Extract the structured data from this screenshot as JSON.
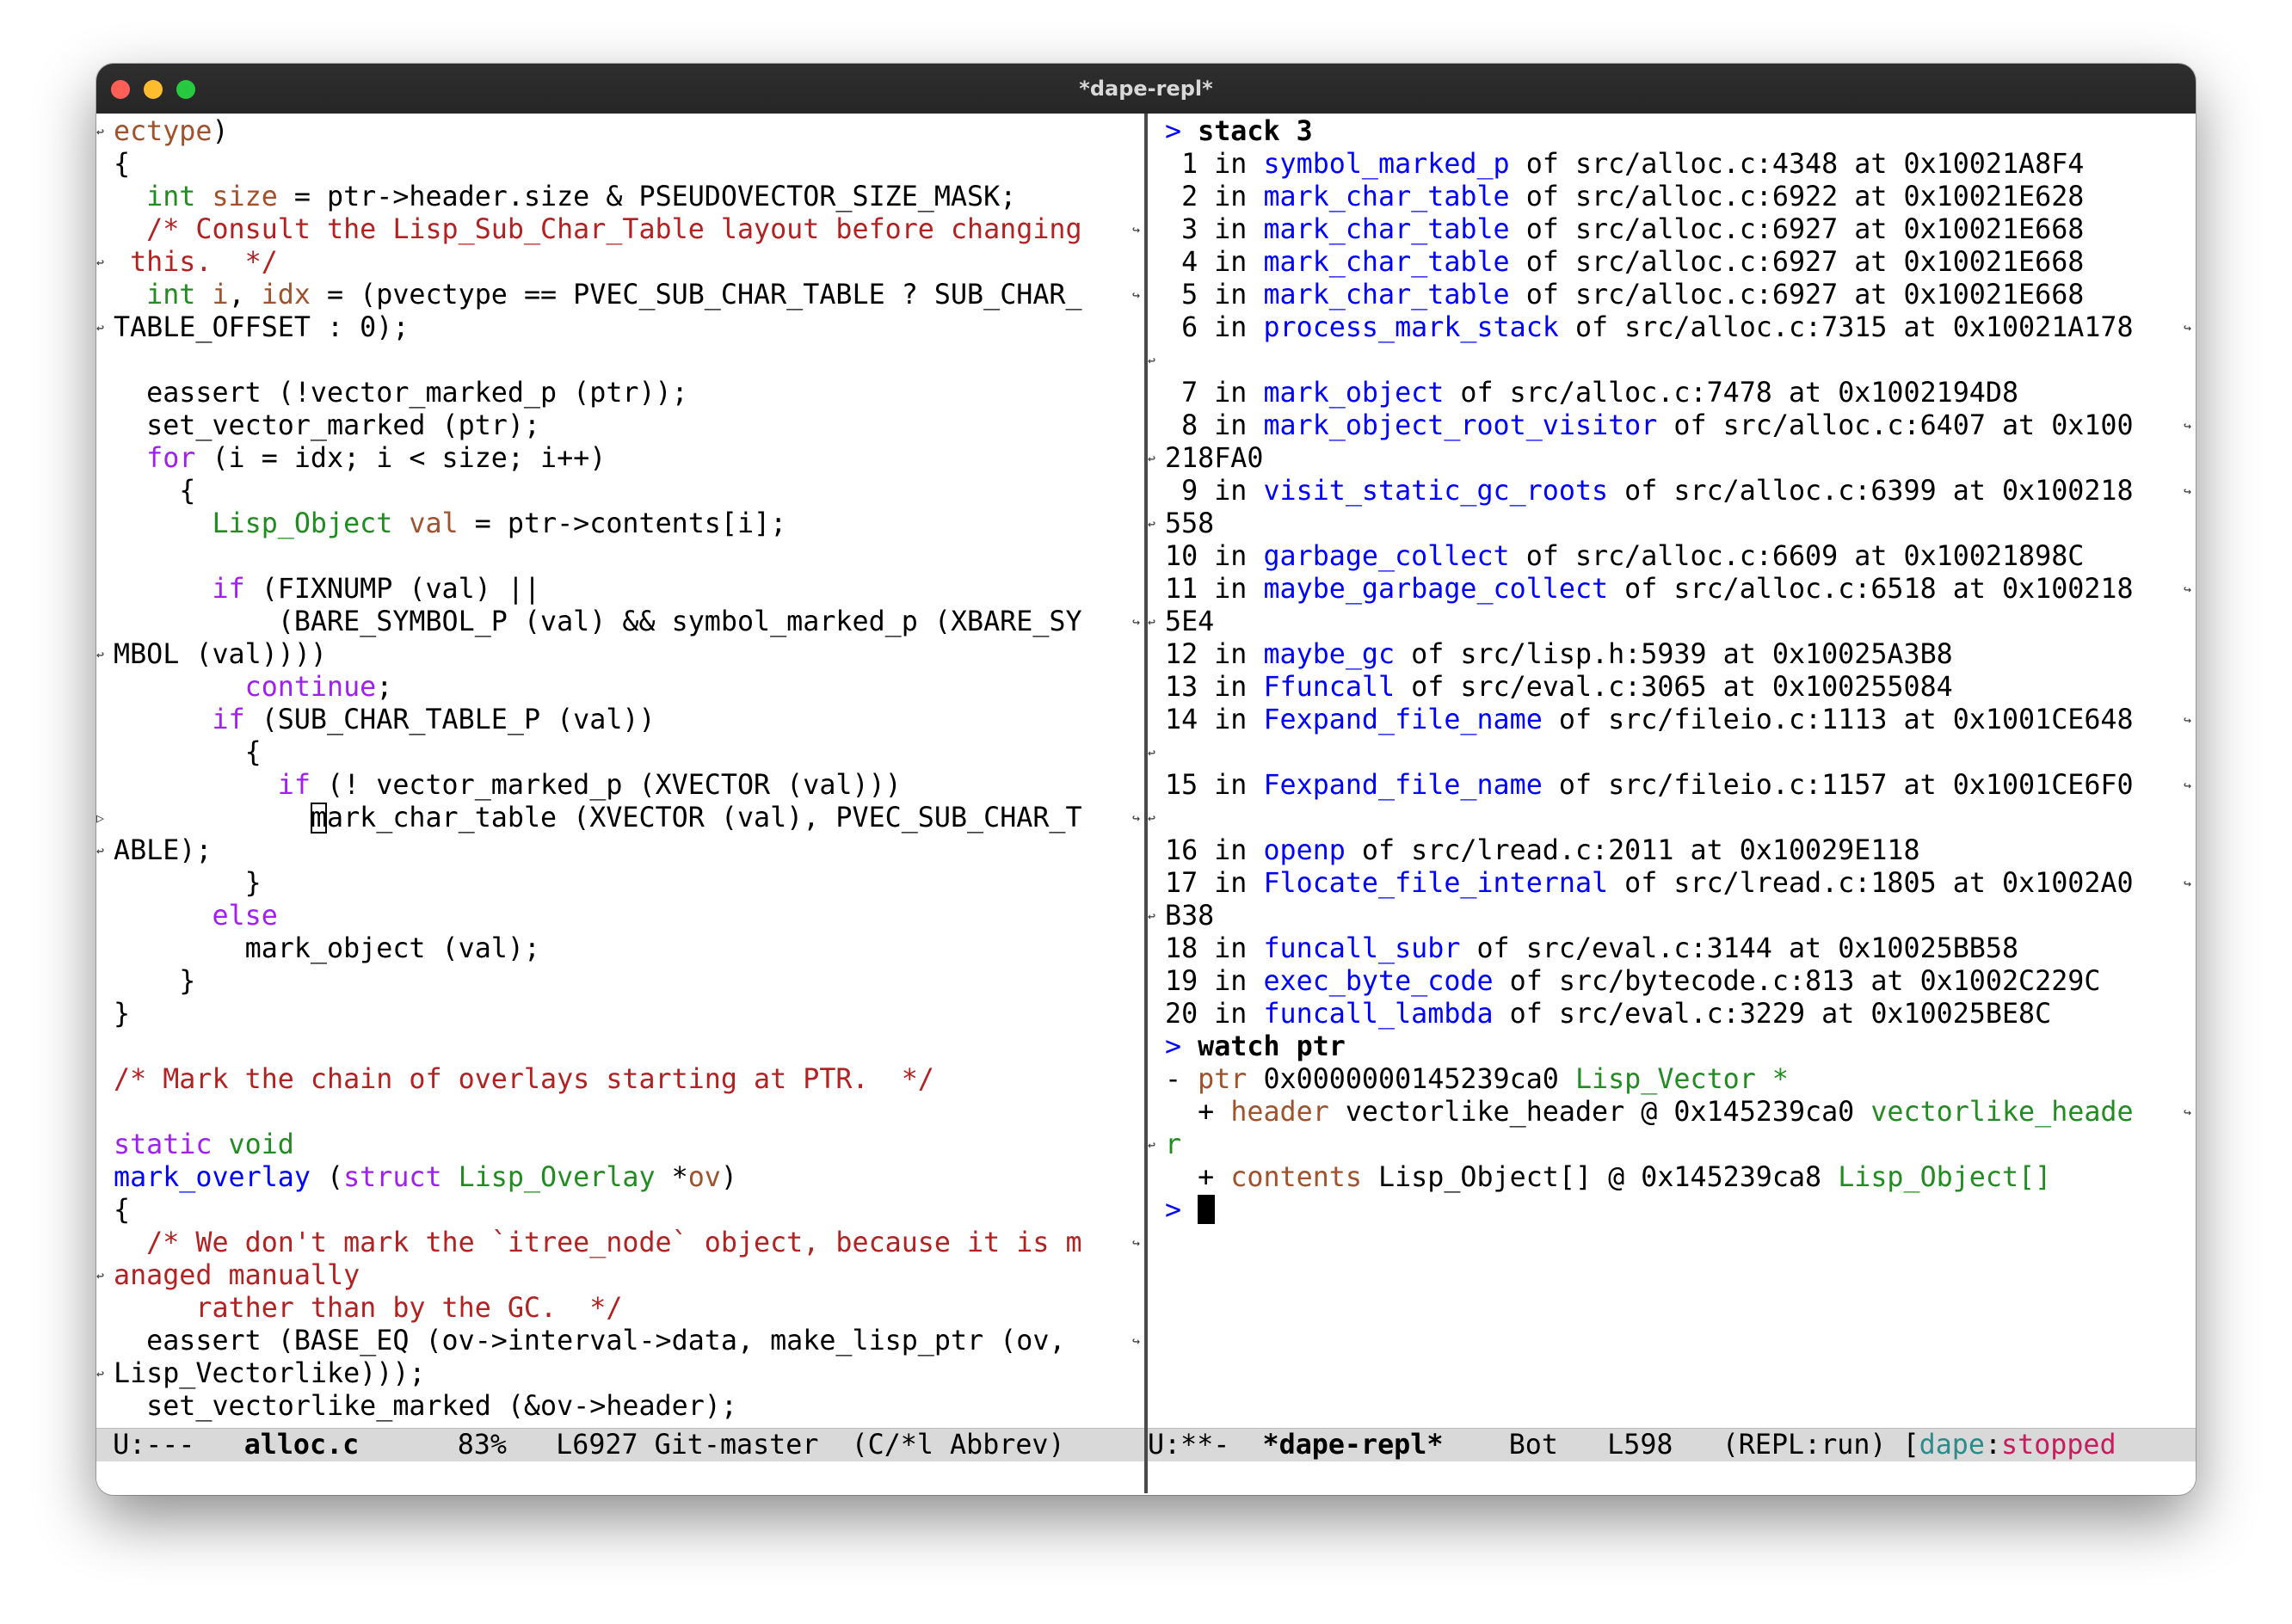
{
  "window": {
    "title": "*dape-repl*"
  },
  "left_pane": {
    "lines": [
      {
        "g": "↩",
        "segs": [
          {
            "c": "vn",
            "t": "ectype"
          },
          {
            "t": ")"
          }
        ]
      },
      {
        "g": "",
        "segs": [
          {
            "t": "{"
          }
        ]
      },
      {
        "g": "",
        "segs": [
          {
            "t": "  "
          },
          {
            "c": "ty",
            "t": "int"
          },
          {
            "t": " "
          },
          {
            "c": "vn",
            "t": "size"
          },
          {
            "t": " = ptr->header.size & PSEUDOVECTOR_SIZE_MASK;"
          }
        ]
      },
      {
        "g": "",
        "r": "↪",
        "segs": [
          {
            "t": "  "
          },
          {
            "c": "cm",
            "t": "/* Consult the Lisp_Sub_Char_Table layout before changing"
          }
        ]
      },
      {
        "g": "↩",
        "segs": [
          {
            "c": "cm",
            "t": " this.  */"
          }
        ]
      },
      {
        "g": "",
        "r": "↪",
        "segs": [
          {
            "t": "  "
          },
          {
            "c": "ty",
            "t": "int"
          },
          {
            "t": " "
          },
          {
            "c": "vn",
            "t": "i"
          },
          {
            "t": ", "
          },
          {
            "c": "vn",
            "t": "idx"
          },
          {
            "t": " = (pvectype == PVEC_SUB_CHAR_TABLE ? SUB_CHAR_"
          }
        ]
      },
      {
        "g": "↩",
        "segs": [
          {
            "t": "TABLE_OFFSET : 0);"
          }
        ]
      },
      {
        "g": "",
        "segs": [
          {
            "t": ""
          }
        ]
      },
      {
        "g": "",
        "segs": [
          {
            "t": "  eassert (!vector_marked_p (ptr));"
          }
        ]
      },
      {
        "g": "",
        "segs": [
          {
            "t": "  set_vector_marked (ptr);"
          }
        ]
      },
      {
        "g": "",
        "segs": [
          {
            "t": "  "
          },
          {
            "c": "kw",
            "t": "for"
          },
          {
            "t": " (i = idx; i < size; i++)"
          }
        ]
      },
      {
        "g": "",
        "segs": [
          {
            "t": "    {"
          }
        ]
      },
      {
        "g": "",
        "segs": [
          {
            "t": "      "
          },
          {
            "c": "ty",
            "t": "Lisp_Object"
          },
          {
            "t": " "
          },
          {
            "c": "vn",
            "t": "val"
          },
          {
            "t": " = ptr->contents[i];"
          }
        ]
      },
      {
        "g": "",
        "segs": [
          {
            "t": ""
          }
        ]
      },
      {
        "g": "",
        "segs": [
          {
            "t": "      "
          },
          {
            "c": "kw",
            "t": "if"
          },
          {
            "t": " (FIXNUMP (val) ||"
          }
        ]
      },
      {
        "g": "",
        "r": "↪",
        "segs": [
          {
            "t": "          (BARE_SYMBOL_P (val) && symbol_marked_p (XBARE_SY"
          }
        ]
      },
      {
        "g": "↩",
        "segs": [
          {
            "t": "MBOL (val))))"
          }
        ]
      },
      {
        "g": "",
        "segs": [
          {
            "t": "        "
          },
          {
            "c": "kw",
            "t": "continue"
          },
          {
            "t": ";"
          }
        ]
      },
      {
        "g": "",
        "segs": [
          {
            "t": "      "
          },
          {
            "c": "kw",
            "t": "if"
          },
          {
            "t": " (SUB_CHAR_TABLE_P (val))"
          }
        ]
      },
      {
        "g": "",
        "segs": [
          {
            "t": "        {"
          }
        ]
      },
      {
        "g": "",
        "segs": [
          {
            "t": "          "
          },
          {
            "c": "kw",
            "t": "if"
          },
          {
            "t": " (! vector_marked_p (XVECTOR (val)))"
          }
        ]
      },
      {
        "g": "▷",
        "r": "↪",
        "segs": [
          {
            "t": "            "
          },
          {
            "c": "cursor",
            "t": "m"
          },
          {
            "t": "ark_char_table (XVECTOR (val), PVEC_SUB_CHAR_T"
          }
        ]
      },
      {
        "g": "↩",
        "segs": [
          {
            "t": "ABLE);"
          }
        ]
      },
      {
        "g": "",
        "segs": [
          {
            "t": "        }"
          }
        ]
      },
      {
        "g": "",
        "segs": [
          {
            "t": "      "
          },
          {
            "c": "kw",
            "t": "else"
          }
        ]
      },
      {
        "g": "",
        "segs": [
          {
            "t": "        mark_object (val);"
          }
        ]
      },
      {
        "g": "",
        "segs": [
          {
            "t": "    }"
          }
        ]
      },
      {
        "g": "",
        "segs": [
          {
            "t": "}"
          }
        ]
      },
      {
        "g": "",
        "segs": [
          {
            "t": ""
          }
        ]
      },
      {
        "g": "",
        "segs": [
          {
            "c": "cm",
            "t": "/* Mark the chain of overlays starting at PTR.  */"
          }
        ]
      },
      {
        "g": "",
        "segs": [
          {
            "t": ""
          }
        ]
      },
      {
        "g": "",
        "segs": [
          {
            "c": "kw",
            "t": "static"
          },
          {
            "t": " "
          },
          {
            "c": "ty",
            "t": "void"
          }
        ]
      },
      {
        "g": "",
        "segs": [
          {
            "c": "fn",
            "t": "mark_overlay"
          },
          {
            "t": " ("
          },
          {
            "c": "kw",
            "t": "struct"
          },
          {
            "t": " "
          },
          {
            "c": "ty",
            "t": "Lisp_Overlay"
          },
          {
            "t": " *"
          },
          {
            "c": "vn",
            "t": "ov"
          },
          {
            "t": ")"
          }
        ]
      },
      {
        "g": "",
        "segs": [
          {
            "t": "{"
          }
        ]
      },
      {
        "g": "",
        "r": "↪",
        "segs": [
          {
            "t": "  "
          },
          {
            "c": "cm",
            "t": "/* We don't mark the `itree_node` object, because it is m"
          }
        ]
      },
      {
        "g": "↩",
        "segs": [
          {
            "c": "cm",
            "t": "anaged manually"
          }
        ]
      },
      {
        "g": "",
        "segs": [
          {
            "c": "cm",
            "t": "     rather than by the GC.  */"
          }
        ]
      },
      {
        "g": "",
        "r": "↪",
        "segs": [
          {
            "t": "  eassert (BASE_EQ (ov->interval->data, make_lisp_ptr (ov, "
          }
        ]
      },
      {
        "g": "↩",
        "segs": [
          {
            "t": "Lisp_Vectorlike)));"
          }
        ]
      },
      {
        "g": "",
        "segs": [
          {
            "t": "  set_vectorlike_marked (&ov->header);"
          }
        ]
      }
    ]
  },
  "right_pane": {
    "lines": [
      {
        "segs": [
          {
            "c": "pr",
            "t": ">"
          },
          {
            "t": " "
          },
          {
            "b": true,
            "t": "stack 3"
          }
        ]
      },
      {
        "segs": [
          {
            "t": " 1 in "
          },
          {
            "c": "fn",
            "t": "symbol_marked_p"
          },
          {
            "t": " of src/alloc.c:4348 at 0x10021A8F4"
          }
        ]
      },
      {
        "segs": [
          {
            "t": " 2 in "
          },
          {
            "c": "fn",
            "t": "mark_char_table"
          },
          {
            "t": " of src/alloc.c:6922 at 0x10021E628"
          }
        ]
      },
      {
        "segs": [
          {
            "t": " 3 in "
          },
          {
            "c": "fn",
            "t": "mark_char_table"
          },
          {
            "t": " of src/alloc.c:6927 at 0x10021E668"
          }
        ]
      },
      {
        "segs": [
          {
            "t": " 4 in "
          },
          {
            "c": "fn",
            "t": "mark_char_table"
          },
          {
            "t": " of src/alloc.c:6927 at 0x10021E668"
          }
        ]
      },
      {
        "segs": [
          {
            "t": " 5 in "
          },
          {
            "c": "fn",
            "t": "mark_char_table"
          },
          {
            "t": " of src/alloc.c:6927 at 0x10021E668"
          }
        ]
      },
      {
        "r": "↪",
        "segs": [
          {
            "t": " 6 in "
          },
          {
            "c": "fn",
            "t": "process_mark_stack"
          },
          {
            "t": " of src/alloc.c:7315 at 0x10021A178"
          }
        ]
      },
      {
        "g": "↩",
        "segs": [
          {
            "t": ""
          }
        ]
      },
      {
        "segs": [
          {
            "t": " 7 in "
          },
          {
            "c": "fn",
            "t": "mark_object"
          },
          {
            "t": " of src/alloc.c:7478 at 0x1002194D8"
          }
        ]
      },
      {
        "r": "↪",
        "segs": [
          {
            "t": " 8 in "
          },
          {
            "c": "fn",
            "t": "mark_object_root_visitor"
          },
          {
            "t": " of src/alloc.c:6407 at 0x100"
          }
        ]
      },
      {
        "g": "↩",
        "segs": [
          {
            "t": "218FA0"
          }
        ]
      },
      {
        "r": "↪",
        "segs": [
          {
            "t": " 9 in "
          },
          {
            "c": "fn",
            "t": "visit_static_gc_roots"
          },
          {
            "t": " of src/alloc.c:6399 at 0x100218"
          }
        ]
      },
      {
        "g": "↩",
        "segs": [
          {
            "t": "558"
          }
        ]
      },
      {
        "segs": [
          {
            "t": "10 in "
          },
          {
            "c": "fn",
            "t": "garbage_collect"
          },
          {
            "t": " of src/alloc.c:6609 at 0x10021898C"
          }
        ]
      },
      {
        "r": "↪",
        "segs": [
          {
            "t": "11 in "
          },
          {
            "c": "fn",
            "t": "maybe_garbage_collect"
          },
          {
            "t": " of src/alloc.c:6518 at 0x100218"
          }
        ]
      },
      {
        "g": "↩",
        "segs": [
          {
            "t": "5E4"
          }
        ]
      },
      {
        "segs": [
          {
            "t": "12 in "
          },
          {
            "c": "fn",
            "t": "maybe_gc"
          },
          {
            "t": " of src/lisp.h:5939 at 0x10025A3B8"
          }
        ]
      },
      {
        "segs": [
          {
            "t": "13 in "
          },
          {
            "c": "fn",
            "t": "Ffuncall"
          },
          {
            "t": " of src/eval.c:3065 at 0x100255084"
          }
        ]
      },
      {
        "r": "↪",
        "segs": [
          {
            "t": "14 in "
          },
          {
            "c": "fn",
            "t": "Fexpand_file_name"
          },
          {
            "t": " of src/fileio.c:1113 at 0x1001CE648"
          }
        ]
      },
      {
        "g": "↩",
        "segs": [
          {
            "t": ""
          }
        ]
      },
      {
        "r": "↪",
        "segs": [
          {
            "t": "15 in "
          },
          {
            "c": "fn",
            "t": "Fexpand_file_name"
          },
          {
            "t": " of src/fileio.c:1157 at 0x1001CE6F0"
          }
        ]
      },
      {
        "g": "↩",
        "segs": [
          {
            "t": ""
          }
        ]
      },
      {
        "segs": [
          {
            "t": "16 in "
          },
          {
            "c": "fn",
            "t": "openp"
          },
          {
            "t": " of src/lread.c:2011 at 0x10029E118"
          }
        ]
      },
      {
        "r": "↪",
        "segs": [
          {
            "t": "17 in "
          },
          {
            "c": "fn",
            "t": "Flocate_file_internal"
          },
          {
            "t": " of src/lread.c:1805 at 0x1002A0"
          }
        ]
      },
      {
        "g": "↩",
        "segs": [
          {
            "t": "B38"
          }
        ]
      },
      {
        "segs": [
          {
            "t": "18 in "
          },
          {
            "c": "fn",
            "t": "funcall_subr"
          },
          {
            "t": " of src/eval.c:3144 at 0x10025BB58"
          }
        ]
      },
      {
        "segs": [
          {
            "t": "19 in "
          },
          {
            "c": "fn",
            "t": "exec_byte_code"
          },
          {
            "t": " of src/bytecode.c:813 at 0x1002C229C"
          }
        ]
      },
      {
        "segs": [
          {
            "t": "20 in "
          },
          {
            "c": "fn",
            "t": "funcall_lambda"
          },
          {
            "t": " of src/eval.c:3229 at 0x10025BE8C"
          }
        ]
      },
      {
        "segs": [
          {
            "c": "pr",
            "t": ">"
          },
          {
            "t": " "
          },
          {
            "b": true,
            "t": "watch ptr"
          }
        ]
      },
      {
        "segs": [
          {
            "t": "- "
          },
          {
            "c": "vn",
            "t": "ptr"
          },
          {
            "t": " 0x0000000145239ca0 "
          },
          {
            "c": "ty",
            "t": "Lisp_Vector *"
          }
        ]
      },
      {
        "r": "↪",
        "segs": [
          {
            "t": "  + "
          },
          {
            "c": "vn",
            "t": "header"
          },
          {
            "t": " vectorlike_header @ 0x145239ca0 "
          },
          {
            "c": "ty",
            "t": "vectorlike_heade"
          }
        ]
      },
      {
        "g": "↩",
        "segs": [
          {
            "c": "ty",
            "t": "r"
          }
        ]
      },
      {
        "segs": [
          {
            "t": "  + "
          },
          {
            "c": "vn",
            "t": "contents"
          },
          {
            "t": " Lisp_Object[] @ 0x145239ca8 "
          },
          {
            "c": "ty",
            "t": "Lisp_Object[]"
          }
        ]
      },
      {
        "segs": [
          {
            "c": "pr",
            "t": ">"
          },
          {
            "t": " "
          },
          {
            "c": "cursorblock",
            "t": ""
          }
        ]
      }
    ]
  },
  "modeline_left": {
    "status": " U:---   ",
    "buffer": "alloc.c",
    "rest": "      83%   L6927 Git-master  (C/*l Abbrev)"
  },
  "modeline_right": {
    "status": "U:**-  ",
    "buffer": "*dape-repl*",
    "rest": "    Bot   L598   (REPL:run) [",
    "dape": "dape",
    "colon": ":",
    "stopped": "stopped"
  }
}
